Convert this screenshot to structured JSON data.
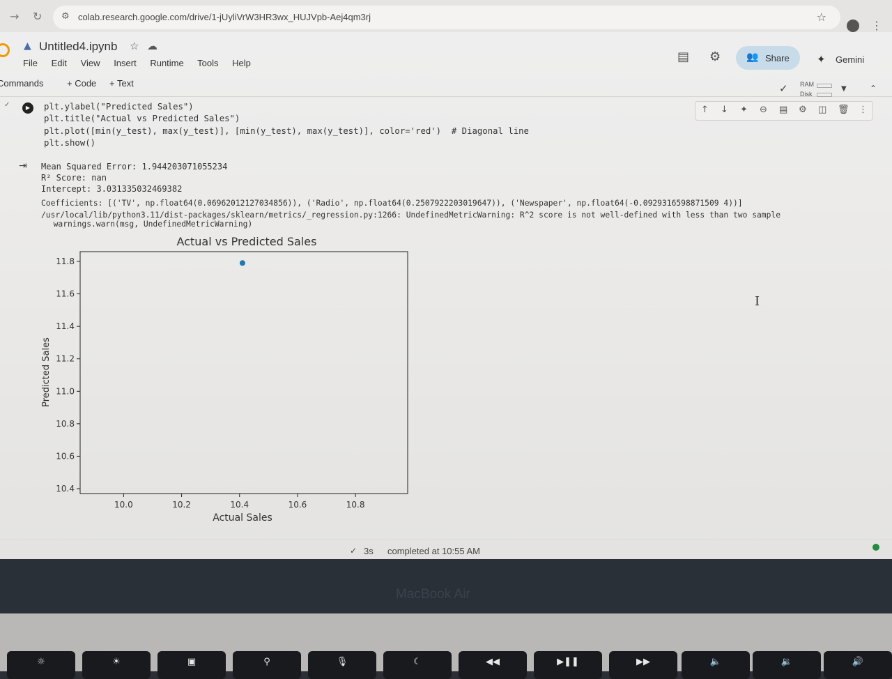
{
  "browser": {
    "url": "colab.research.google.com/drive/1-jUyliVrW3HR3wx_HUJVpb-Aej4qm3rj"
  },
  "notebook": {
    "title": "Untitled4.ipynb",
    "menu": [
      "File",
      "Edit",
      "View",
      "Insert",
      "Runtime",
      "Tools",
      "Help"
    ],
    "share_label": "Share",
    "gemini_label": "Gemini"
  },
  "toolbar": {
    "commands_label": "Commands",
    "add_code": "+ Code",
    "add_text": "+ Text",
    "ram_label": "RAM",
    "disk_label": "Disk"
  },
  "cell": {
    "code_lines": {
      "ylabel": "plt.ylabel(\"Predicted Sales\")",
      "title": "plt.title(\"Actual vs Predicted Sales\")",
      "plot": "plt.plot([min(y_test), max(y_test)], [min(y_test), max(y_test)], color='red')  # Diagonal line",
      "show": "plt.show()"
    },
    "output_lines": [
      "Mean Squared Error: 1.944203071055234",
      "R² Score: nan",
      "Intercept: 3.031335032469382",
      "Coefficients: [('TV', np.float64(0.06962012127034856)), ('Radio', np.float64(0.2507922203019647)), ('Newspaper', np.float64(-0.0929316598871509 4))]",
      "/usr/local/lib/python3.11/dist-packages/sklearn/metrics/_regression.py:1266: UndefinedMetricWarning: R^2 score is not well-defined with less than two sample",
      "  warnings.warn(msg, UndefinedMetricWarning)"
    ]
  },
  "chart_data": {
    "type": "scatter",
    "title": "Actual vs Predicted Sales",
    "xlabel": "Actual Sales",
    "ylabel": "Predicted Sales",
    "xlim": [
      9.85,
      10.98
    ],
    "ylim": [
      10.37,
      11.86
    ],
    "xticks": [
      10.0,
      10.2,
      10.4,
      10.6,
      10.8
    ],
    "xtick_labels": [
      "10.0",
      "10.2",
      "10.4",
      "10.6",
      "10.8"
    ],
    "yticks": [
      10.4,
      10.6,
      10.8,
      11.0,
      11.2,
      11.4,
      11.6,
      11.8
    ],
    "ytick_labels": [
      "10.4",
      "10.6",
      "10.8",
      "11.0",
      "11.2",
      "11.4",
      "11.6",
      "11.8"
    ],
    "points": [
      {
        "x": 10.41,
        "y": 11.79
      }
    ],
    "point_color": "#1f77b4",
    "grid": false
  },
  "status": {
    "duration": "3s",
    "text": "completed at 10:55 AM"
  },
  "bezel_label": "MacBook Air",
  "keys": [
    "F1",
    "F2",
    "F3",
    "F4",
    "F5",
    "F6",
    "F7",
    "F8",
    "F9",
    "F10",
    "F11",
    "F12"
  ]
}
